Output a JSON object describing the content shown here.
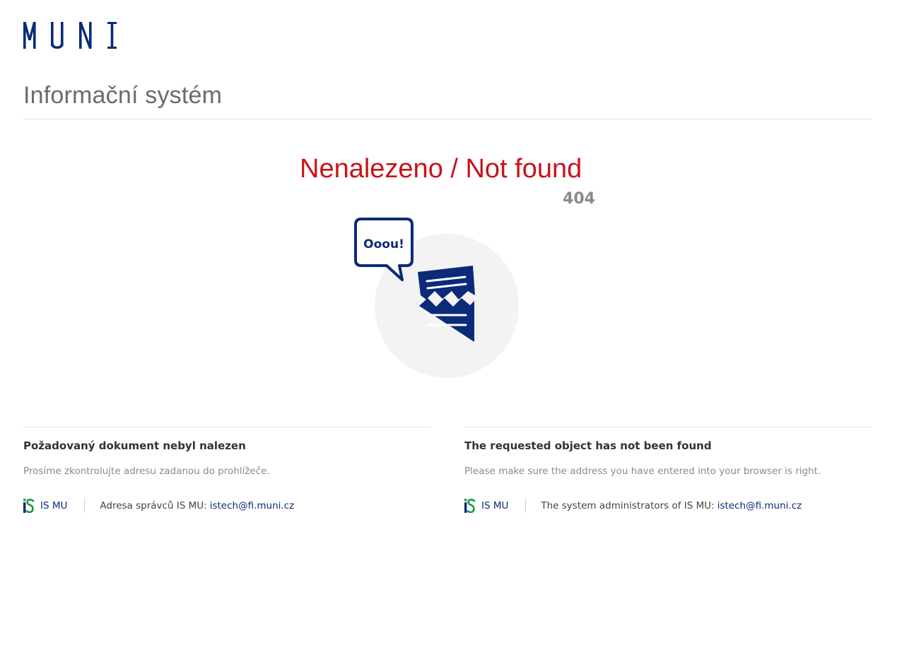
{
  "header": {
    "logo_text": "MUNI",
    "site_title": "Informační systém"
  },
  "error": {
    "title": "Nenalezeno / Not found",
    "code": "404",
    "bubble_text": "Ooou!"
  },
  "columns": [
    {
      "heading": "Požadovaný dokument nebyl nalezen",
      "text": "Prosíme zkontrolujte adresu zadanou do prohlížeče.",
      "is_link_label": "IS MU",
      "admin_label": "Adresa správců IS MU:",
      "email": "istech@fi.muni.cz"
    },
    {
      "heading": "The requested object has not been found",
      "text": "Please make sure the address you have entered into your browser is right.",
      "is_link_label": "IS MU",
      "admin_label": "The system administrators of IS MU:",
      "email": "istech@fi.muni.cz"
    }
  ],
  "colors": {
    "brand_blue": "#0b2a7a",
    "error_red": "#c8131b",
    "is_green": "#1a9a3c"
  },
  "icons": {
    "logo": "muni-logo-icon",
    "illustration": "torn-document-icon",
    "is_logo": "is-mu-logo-icon"
  }
}
